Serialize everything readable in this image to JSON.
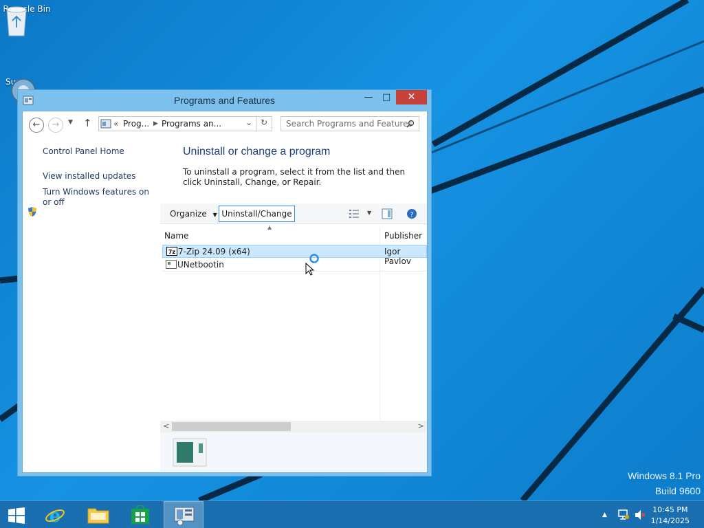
{
  "desktop": {
    "icons": [
      {
        "label": "Recycle Bin"
      },
      {
        "label": "Sup"
      }
    ],
    "watermark": {
      "line1": "Windows 8.1 Pro",
      "line2": "Build 9600"
    }
  },
  "window": {
    "title": "Programs and Features",
    "controls": {
      "minimize": "—",
      "maximize": "□",
      "close": "✕"
    },
    "address": {
      "sep": "«",
      "crumb1": "Prog...",
      "crumb2": "Programs an...",
      "dropdown": "⌄",
      "refresh": "↻"
    },
    "search": {
      "placeholder": "Search Programs and Features"
    },
    "left_pane": {
      "links": [
        "Control Panel Home",
        "View installed updates",
        "Turn Windows features on or off"
      ]
    },
    "main": {
      "heading": "Uninstall or change a program",
      "description": "To uninstall a program, select it from the list and then click Uninstall, Change, or Repair.",
      "toolbar": {
        "organize": "Organize",
        "uninstall_change": "Uninstall/Change"
      },
      "columns": {
        "name": "Name",
        "publisher": "Publisher"
      },
      "programs": [
        {
          "name": "7-Zip 24.09 (x64)",
          "publisher": "Igor Pavlov",
          "selected": true,
          "icon": "7zip-icon"
        },
        {
          "name": "UNetbootin",
          "publisher": "",
          "selected": false,
          "icon": "app-window-icon"
        }
      ]
    }
  },
  "taskbar": {
    "apps": [
      "start",
      "internet-explorer",
      "file-explorer",
      "store",
      "programs-and-features"
    ],
    "clock": {
      "time": "10:45 PM",
      "date": "1/14/2025"
    }
  },
  "colors": {
    "accent": "#1a6fb0",
    "window_frame": "#7cc0ee",
    "close": "#c7413b",
    "link": "#1e3b62",
    "heading": "#1a3e80"
  }
}
